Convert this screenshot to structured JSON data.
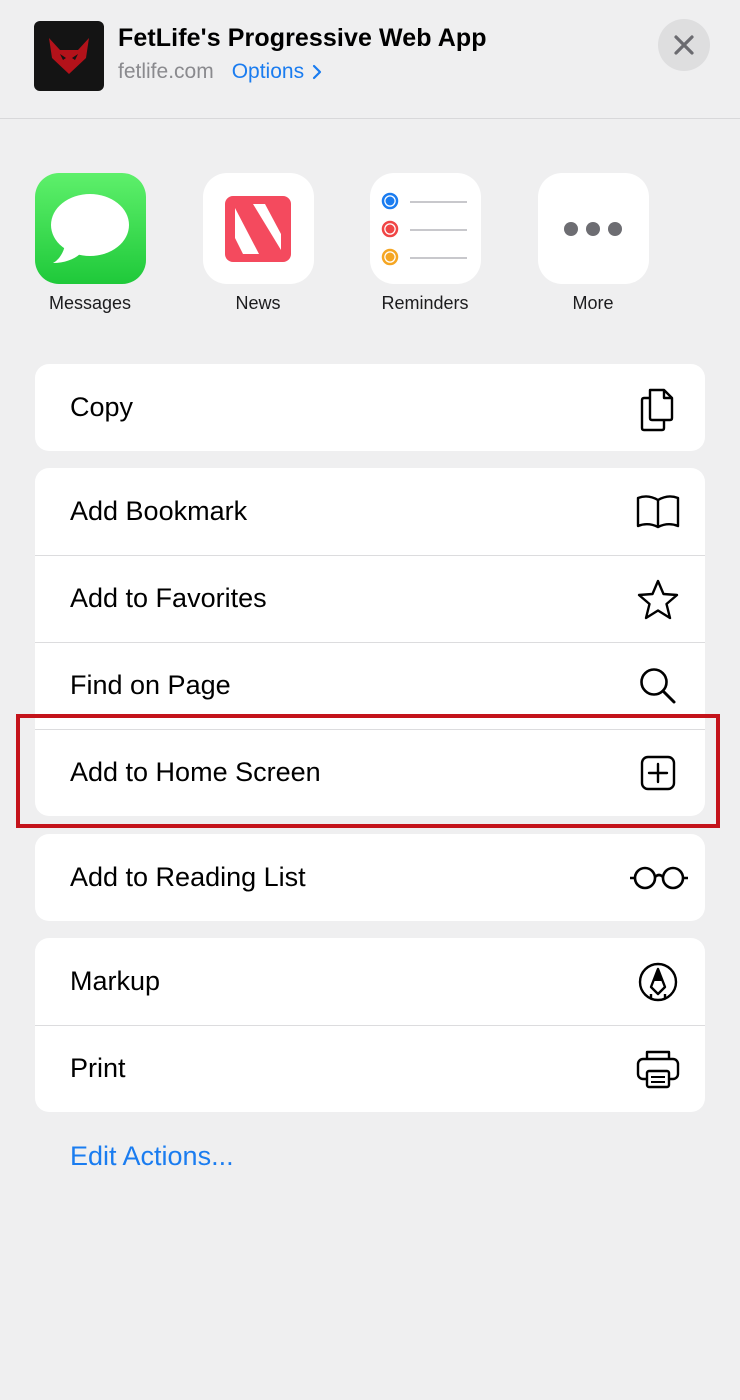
{
  "header": {
    "title": "FetLife's Progressive Web App",
    "domain": "fetlife.com",
    "options_label": "Options",
    "close_icon": "close-icon"
  },
  "apps": [
    {
      "label": "Messages",
      "icon": "messages-icon"
    },
    {
      "label": "News",
      "icon": "news-icon"
    },
    {
      "label": "Reminders",
      "icon": "reminders-icon"
    },
    {
      "label": "More",
      "icon": "more-icon"
    }
  ],
  "actions": {
    "copy": {
      "label": "Copy",
      "icon": "copy-icon"
    },
    "add_bookmark": {
      "label": "Add Bookmark",
      "icon": "book-icon"
    },
    "add_to_favorites": {
      "label": "Add to Favorites",
      "icon": "star-icon"
    },
    "find_on_page": {
      "label": "Find on Page",
      "icon": "search-icon"
    },
    "add_to_home_screen": {
      "label": "Add to Home Screen",
      "icon": "plus-square-icon"
    },
    "add_to_reading_list": {
      "label": "Add to Reading List",
      "icon": "glasses-icon"
    },
    "markup": {
      "label": "Markup",
      "icon": "markup-pen-icon"
    },
    "print": {
      "label": "Print",
      "icon": "printer-icon"
    }
  },
  "footer": {
    "edit_actions_label": "Edit Actions..."
  },
  "colors": {
    "accent": "#1a7cf0",
    "highlight": "#c4131b",
    "background": "#efeff0"
  }
}
